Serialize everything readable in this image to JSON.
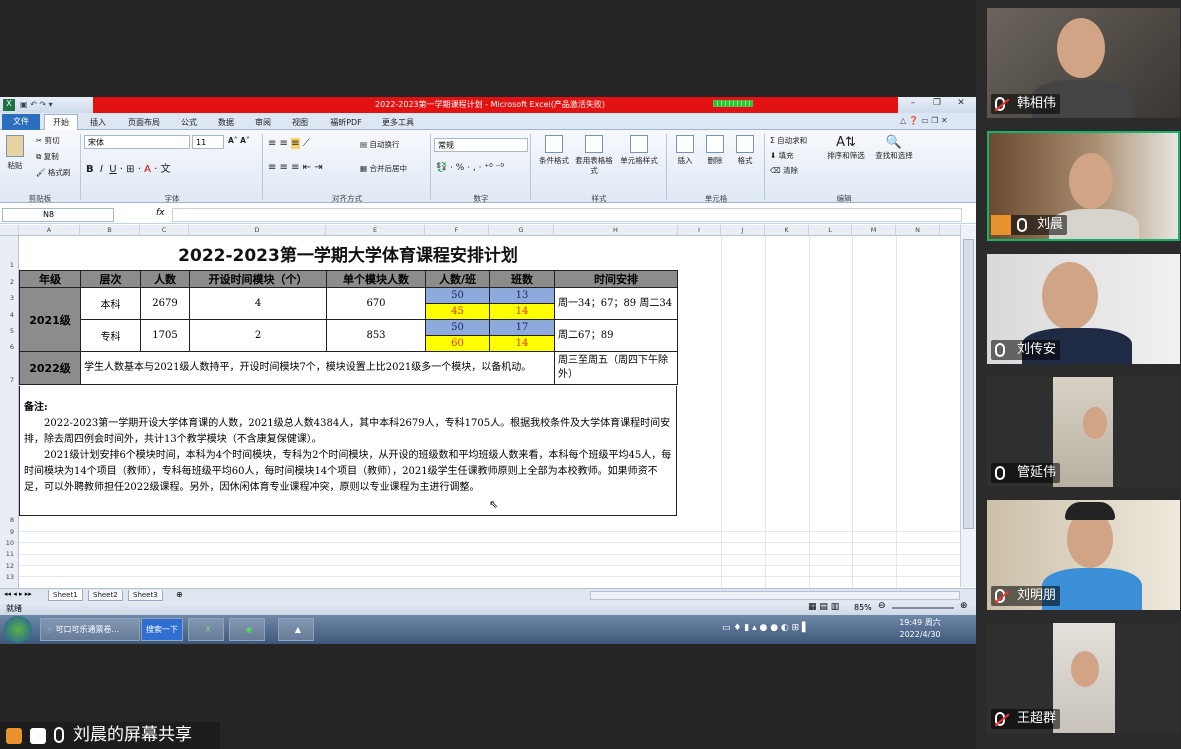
{
  "excel": {
    "window_title": "2022-2023第一学期课程计划 - Microsoft Excel(产品激活失败)",
    "tabs": [
      "文件",
      "开始",
      "插入",
      "页面布局",
      "公式",
      "数据",
      "审阅",
      "视图",
      "福昕PDF",
      "更多工具"
    ],
    "ribbon": {
      "clipboard": {
        "paste": "粘贴",
        "cut": "剪切",
        "copy": "复制",
        "format_painter": "格式刷",
        "group": "剪贴板"
      },
      "font": {
        "name": "宋体",
        "size": "11",
        "group": "字体"
      },
      "align": {
        "wrap": "自动换行",
        "merge": "合并后居中",
        "group": "对齐方式"
      },
      "number": {
        "format": "常规",
        "group": "数字"
      },
      "styles": {
        "cond": "条件格式",
        "table": "套用表格格式",
        "cell": "单元格样式",
        "group": "样式"
      },
      "cells": {
        "insert": "插入",
        "delete": "删除",
        "format": "格式",
        "group": "单元格"
      },
      "edit": {
        "autosum": "自动求和",
        "fill": "填充",
        "clear": "清除",
        "sort": "排序和筛选",
        "find": "查找和选择",
        "group": "编辑"
      }
    },
    "name_box": "N8",
    "fx": "fx",
    "columns": [
      "A",
      "B",
      "C",
      "D",
      "E",
      "F",
      "G",
      "H",
      "I",
      "J",
      "K",
      "L",
      "M",
      "N"
    ],
    "rows": [
      "1",
      "2",
      "3",
      "4",
      "5",
      "6",
      "7",
      "8",
      "9",
      "10",
      "11",
      "12",
      "13"
    ],
    "sheet_title": "2022-2023第一学期大学体育课程安排计划",
    "headers": [
      "年级",
      "层次",
      "人数",
      "开设时间模块（个）",
      "单个模块人数",
      "人数/班",
      "班数",
      "时间安排"
    ],
    "grade_2021": "2021级",
    "benke": {
      "level": "本科",
      "count": "2679",
      "modules": "4",
      "per_module": "670",
      "p1": "50",
      "c1": "13",
      "p2": "45",
      "c2": "14",
      "time": "周一34；67；89 周二34"
    },
    "zhuanke": {
      "level": "专科",
      "count": "1705",
      "modules": "2",
      "per_module": "853",
      "p1": "50",
      "c1": "17",
      "p2": "60",
      "c2": "14",
      "time": "周二67；89"
    },
    "grade_2022": "2022级",
    "grade_2022_text": "学生人数基本与2021级人数持平，开设时间模块7个，模块设置上比2021级多一个模块，以备机动。",
    "grade_2022_time": "周三至周五（周四下午除外）",
    "notes_title": "备注:",
    "notes_p1": "2022-2023第一学期开设大学体育课的人数，2021级总人数4384人，其中本科2679人，专科1705人。根据我校条件及大学体育课程时间安排，除去周四例会时间外，共计13个教学模块（不含康复保健课）。",
    "notes_p2": "2021级计划安排6个模块时间，本科为4个时间模块，专科为2个时间模块，从开设的班级数和平均班级人数来看，本科每个班级平均45人，每时间模块为14个项目（教师），专科每班级平均60人，每时间模块14个项目（教师），2021级学生任课教师原则上全部为本校教师。如果师资不足，可以外聘教师担任2022级课程。另外，因休闲体育专业课程冲突，原则以专业课程为主进行调整。",
    "sheet_tabs": [
      "Sheet1",
      "Sheet2",
      "Sheet3"
    ],
    "status": "就绪",
    "zoom": "85%"
  },
  "taskbar": {
    "ie_item": "可口可乐通票卷...",
    "search": "搜索一下",
    "time": "19:49 周六",
    "date": "2022/4/30"
  },
  "share_label": "刘晨的屏幕共享",
  "participants": [
    {
      "name": "韩相伟",
      "muted": true
    },
    {
      "name": "刘晨",
      "muted": false,
      "active": true
    },
    {
      "name": "刘传安",
      "muted": false
    },
    {
      "name": "管延伟",
      "muted": false
    },
    {
      "name": "刘明朋",
      "muted": true
    },
    {
      "name": "王超群",
      "muted": true
    }
  ],
  "colors": {
    "excel_title_red": "#e31212",
    "header_gray": "#8c8c8c",
    "blue_cell": "#8ea9db",
    "yellow_cell": "#ffff00",
    "active_green": "#17b36b"
  }
}
